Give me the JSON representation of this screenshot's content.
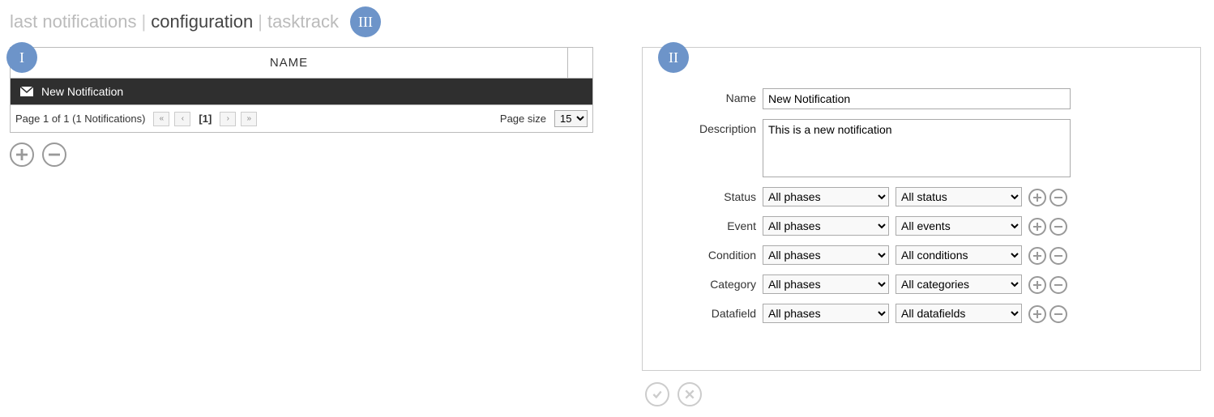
{
  "tabs": {
    "last_notifications": "last notifications",
    "configuration": "configuration",
    "tasktrack": "tasktrack"
  },
  "markers": {
    "one": "I",
    "two": "II",
    "three": "III"
  },
  "table": {
    "header_name": "NAME",
    "row_label": "New Notification",
    "pager_info": "Page 1 of 1 (1 Notifications)",
    "current_page": "[1]",
    "page_size_label": "Page size",
    "page_size_value": "15"
  },
  "form": {
    "labels": {
      "name": "Name",
      "description": "Description",
      "status": "Status",
      "event": "Event",
      "condition": "Condition",
      "category": "Category",
      "datafield": "Datafield"
    },
    "values": {
      "name": "New Notification",
      "description": "This is a new notification"
    },
    "selects": {
      "all_phases": "All phases",
      "all_status": "All status",
      "all_events": "All events",
      "all_conditions": "All conditions",
      "all_categories": "All categories",
      "all_datafields": "All datafields"
    }
  }
}
